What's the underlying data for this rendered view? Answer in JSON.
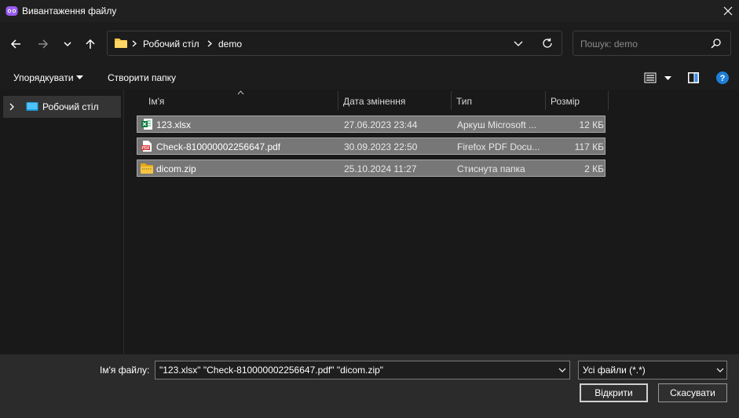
{
  "window": {
    "title": "Вивантаження файлу",
    "app_icon": "app-mask-icon"
  },
  "nav": {
    "back_icon": "arrow-left-icon",
    "forward_icon": "arrow-right-icon",
    "recent_icon": "chevron-down-icon",
    "up_icon": "arrow-up-icon"
  },
  "address": {
    "breadcrumb": [
      "Робочий стіл",
      "demo"
    ]
  },
  "search": {
    "placeholder": "Пошук: demo"
  },
  "toolbar": {
    "organize_label": "Упорядкувати",
    "new_folder_label": "Створити папку"
  },
  "navpane": {
    "items": [
      {
        "label": "Робочий стіл",
        "icon": "desktop-icon"
      }
    ]
  },
  "filelist": {
    "columns": [
      "Ім'я",
      "Дата змінення",
      "Тип",
      "Розмір"
    ],
    "rows": [
      {
        "name": "123.xlsx",
        "date": "27.06.2023 23:44",
        "type": "Аркуш Microsoft ...",
        "size": "12 КБ",
        "icon": "excel-file-icon"
      },
      {
        "name": "Check-810000002256647.pdf",
        "date": "30.09.2023 22:50",
        "type": "Firefox PDF Docu...",
        "size": "117 КБ",
        "icon": "pdf-file-icon"
      },
      {
        "name": "dicom.zip",
        "date": "25.10.2024 11:27",
        "type": "Стиснута папка",
        "size": "2 КБ",
        "icon": "zip-folder-icon"
      }
    ]
  },
  "bottom": {
    "filename_label": "Ім'я файлу:",
    "filename_value": "\"123.xlsx\" \"Check-810000002256647.pdf\" \"dicom.zip\"",
    "filetype_value": "Усі файли (*.*)",
    "open_label": "Відкрити",
    "cancel_label": "Скасувати"
  },
  "colors": {
    "selection_bg": "#777777",
    "selection_border": "#a8a8a8",
    "help_blue": "#1e7fd8",
    "folder_yellow": "#f5c542"
  }
}
